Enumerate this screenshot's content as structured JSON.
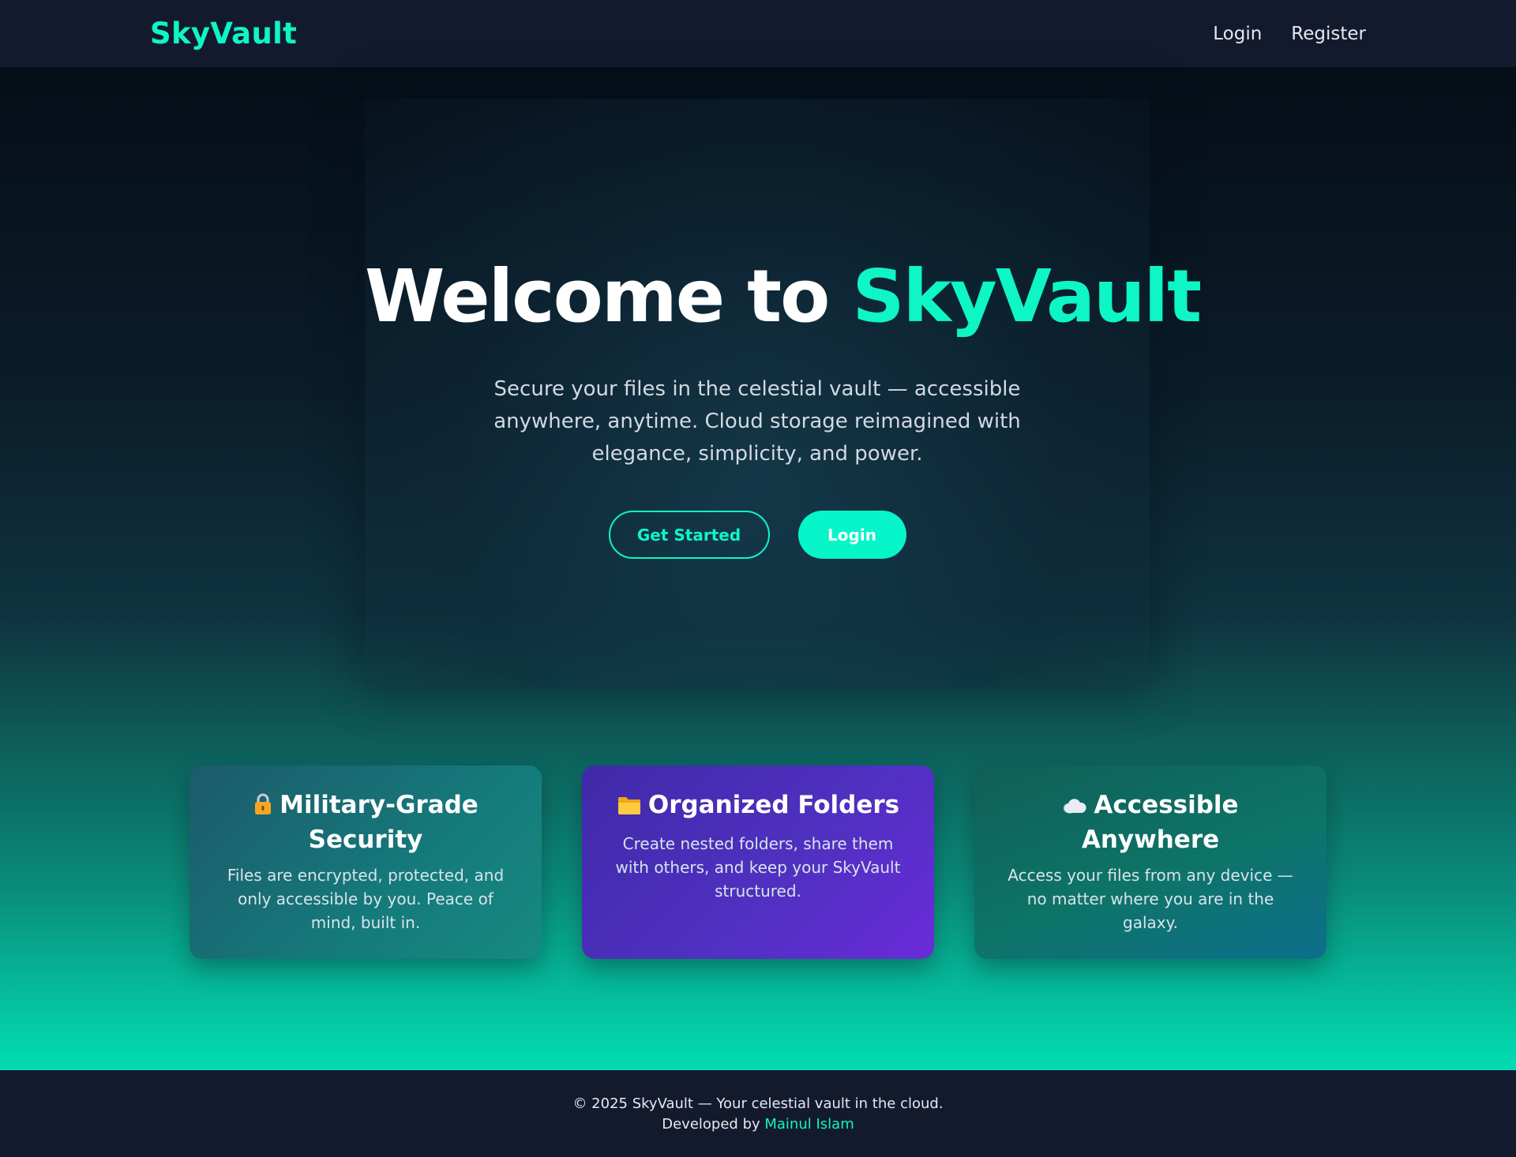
{
  "navbar": {
    "brand": "SkyVault",
    "links": {
      "login": "Login",
      "register": "Register"
    }
  },
  "hero": {
    "title_prefix": "Welcome to ",
    "title_accent": "SkyVault",
    "subtitle": "Secure your files in the celestial vault — accessible anywhere, anytime. Cloud storage reimagined with elegance, simplicity, and power.",
    "buttons": {
      "get_started": "Get Started",
      "login": "Login"
    }
  },
  "features": [
    {
      "icon": "lock-icon",
      "title": "Military-Grade Security",
      "description": "Files are encrypted, protected, and only accessible by you. Peace of mind, built in."
    },
    {
      "icon": "folder-icon",
      "title": "Organized Folders",
      "description": "Create nested folders, share them with others, and keep your SkyVault structured."
    },
    {
      "icon": "cloud-icon",
      "title": "Accessible Anywhere",
      "description": "Access your files from any device — no matter where you are in the galaxy."
    }
  ],
  "footer": {
    "copyright": "© 2025 SkyVault — Your celestial vault in the cloud.",
    "developed_by": "Developed by ",
    "developer": "Mainul Islam"
  },
  "colors": {
    "accent": "#0ef5c6",
    "navbar_bg": "#141a2e",
    "card_security": "#157a7b",
    "card_folders": "#4f30c0",
    "card_anywhere": "#0e7468"
  }
}
